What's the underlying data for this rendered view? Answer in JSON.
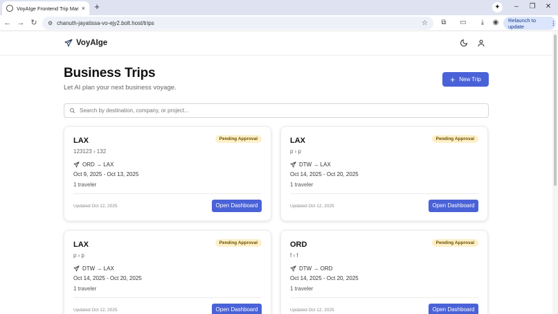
{
  "browser": {
    "tab_title": "VoyAIge Frontend Trip Manage",
    "tab_close": "×",
    "new_tab": "+",
    "url": "chanuth-jayatissa-vo-ejy2.bolt.host/trips",
    "relaunch_label": "Relaunch to update",
    "window_controls": [
      "–",
      "❐",
      "✕"
    ]
  },
  "app": {
    "brand": "VoyAIge"
  },
  "page": {
    "title": "Business Trips",
    "subtitle": "Let AI plan your next business voyage.",
    "new_trip_label": "New Trip",
    "search_placeholder": "Search by destination, company, or project..."
  },
  "trips": [
    {
      "title": "LAX",
      "subtitle": "123123 › 132",
      "status": "Pending Approval",
      "route": "ORD → LAX",
      "dates": "Oct 9, 2025 - Oct 13, 2025",
      "travelers": "1 traveler",
      "updated": "Updated Oct 12, 2025",
      "action": "Open Dashboard"
    },
    {
      "title": "LAX",
      "subtitle": "p › p",
      "status": "Pending Approval",
      "route": "DTW → LAX",
      "dates": "Oct 14, 2025 - Oct 20, 2025",
      "travelers": "1 traveler",
      "updated": "Updated Oct 12, 2025",
      "action": "Open Dashboard"
    },
    {
      "title": "LAX",
      "subtitle": "p › p",
      "status": "Pending Approval",
      "route": "DTW → LAX",
      "dates": "Oct 14, 2025 - Oct 20, 2025",
      "travelers": "1 traveler",
      "updated": "Updated Oct 12, 2025",
      "action": "Open Dashboard"
    },
    {
      "title": "ORD",
      "subtitle": "f › f",
      "status": "Pending Approval",
      "route": "DTW → ORD",
      "dates": "Oct 14, 2025 - Oct 20, 2025",
      "travelers": "1 traveler",
      "updated": "Updated Oct 12, 2025",
      "action": "Open Dashboard"
    }
  ],
  "colors": {
    "accent": "#4a62d7",
    "badge_bg": "#fdf0c8",
    "badge_text": "#6b4e00"
  },
  "icons": {
    "brand": "plane-icon",
    "theme_toggle": "moon-icon",
    "profile": "user-icon",
    "search": "search-icon",
    "route": "plane-icon"
  }
}
